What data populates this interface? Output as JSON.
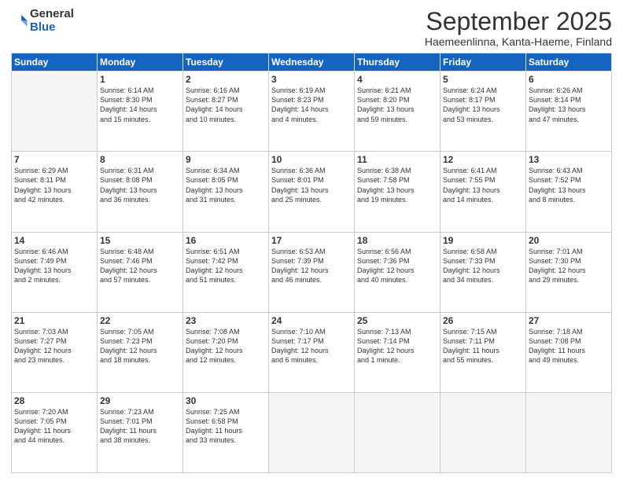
{
  "header": {
    "logo_general": "General",
    "logo_blue": "Blue",
    "month_title": "September 2025",
    "location": "Haemeenlinna, Kanta-Haeme, Finland"
  },
  "columns": [
    "Sunday",
    "Monday",
    "Tuesday",
    "Wednesday",
    "Thursday",
    "Friday",
    "Saturday"
  ],
  "weeks": [
    [
      {
        "day": "",
        "info": ""
      },
      {
        "day": "1",
        "info": "Sunrise: 6:14 AM\nSunset: 8:30 PM\nDaylight: 14 hours\nand 15 minutes."
      },
      {
        "day": "2",
        "info": "Sunrise: 6:16 AM\nSunset: 8:27 PM\nDaylight: 14 hours\nand 10 minutes."
      },
      {
        "day": "3",
        "info": "Sunrise: 6:19 AM\nSunset: 8:23 PM\nDaylight: 14 hours\nand 4 minutes."
      },
      {
        "day": "4",
        "info": "Sunrise: 6:21 AM\nSunset: 8:20 PM\nDaylight: 13 hours\nand 59 minutes."
      },
      {
        "day": "5",
        "info": "Sunrise: 6:24 AM\nSunset: 8:17 PM\nDaylight: 13 hours\nand 53 minutes."
      },
      {
        "day": "6",
        "info": "Sunrise: 6:26 AM\nSunset: 8:14 PM\nDaylight: 13 hours\nand 47 minutes."
      }
    ],
    [
      {
        "day": "7",
        "info": "Sunrise: 6:29 AM\nSunset: 8:11 PM\nDaylight: 13 hours\nand 42 minutes."
      },
      {
        "day": "8",
        "info": "Sunrise: 6:31 AM\nSunset: 8:08 PM\nDaylight: 13 hours\nand 36 minutes."
      },
      {
        "day": "9",
        "info": "Sunrise: 6:34 AM\nSunset: 8:05 PM\nDaylight: 13 hours\nand 31 minutes."
      },
      {
        "day": "10",
        "info": "Sunrise: 6:36 AM\nSunset: 8:01 PM\nDaylight: 13 hours\nand 25 minutes."
      },
      {
        "day": "11",
        "info": "Sunrise: 6:38 AM\nSunset: 7:58 PM\nDaylight: 13 hours\nand 19 minutes."
      },
      {
        "day": "12",
        "info": "Sunrise: 6:41 AM\nSunset: 7:55 PM\nDaylight: 13 hours\nand 14 minutes."
      },
      {
        "day": "13",
        "info": "Sunrise: 6:43 AM\nSunset: 7:52 PM\nDaylight: 13 hours\nand 8 minutes."
      }
    ],
    [
      {
        "day": "14",
        "info": "Sunrise: 6:46 AM\nSunset: 7:49 PM\nDaylight: 13 hours\nand 2 minutes."
      },
      {
        "day": "15",
        "info": "Sunrise: 6:48 AM\nSunset: 7:46 PM\nDaylight: 12 hours\nand 57 minutes."
      },
      {
        "day": "16",
        "info": "Sunrise: 6:51 AM\nSunset: 7:42 PM\nDaylight: 12 hours\nand 51 minutes."
      },
      {
        "day": "17",
        "info": "Sunrise: 6:53 AM\nSunset: 7:39 PM\nDaylight: 12 hours\nand 46 minutes."
      },
      {
        "day": "18",
        "info": "Sunrise: 6:56 AM\nSunset: 7:36 PM\nDaylight: 12 hours\nand 40 minutes."
      },
      {
        "day": "19",
        "info": "Sunrise: 6:58 AM\nSunset: 7:33 PM\nDaylight: 12 hours\nand 34 minutes."
      },
      {
        "day": "20",
        "info": "Sunrise: 7:01 AM\nSunset: 7:30 PM\nDaylight: 12 hours\nand 29 minutes."
      }
    ],
    [
      {
        "day": "21",
        "info": "Sunrise: 7:03 AM\nSunset: 7:27 PM\nDaylight: 12 hours\nand 23 minutes."
      },
      {
        "day": "22",
        "info": "Sunrise: 7:05 AM\nSunset: 7:23 PM\nDaylight: 12 hours\nand 18 minutes."
      },
      {
        "day": "23",
        "info": "Sunrise: 7:08 AM\nSunset: 7:20 PM\nDaylight: 12 hours\nand 12 minutes."
      },
      {
        "day": "24",
        "info": "Sunrise: 7:10 AM\nSunset: 7:17 PM\nDaylight: 12 hours\nand 6 minutes."
      },
      {
        "day": "25",
        "info": "Sunrise: 7:13 AM\nSunset: 7:14 PM\nDaylight: 12 hours\nand 1 minute."
      },
      {
        "day": "26",
        "info": "Sunrise: 7:15 AM\nSunset: 7:11 PM\nDaylight: 11 hours\nand 55 minutes."
      },
      {
        "day": "27",
        "info": "Sunrise: 7:18 AM\nSunset: 7:08 PM\nDaylight: 11 hours\nand 49 minutes."
      }
    ],
    [
      {
        "day": "28",
        "info": "Sunrise: 7:20 AM\nSunset: 7:05 PM\nDaylight: 11 hours\nand 44 minutes."
      },
      {
        "day": "29",
        "info": "Sunrise: 7:23 AM\nSunset: 7:01 PM\nDaylight: 11 hours\nand 38 minutes."
      },
      {
        "day": "30",
        "info": "Sunrise: 7:25 AM\nSunset: 6:58 PM\nDaylight: 11 hours\nand 33 minutes."
      },
      {
        "day": "",
        "info": ""
      },
      {
        "day": "",
        "info": ""
      },
      {
        "day": "",
        "info": ""
      },
      {
        "day": "",
        "info": ""
      }
    ]
  ]
}
